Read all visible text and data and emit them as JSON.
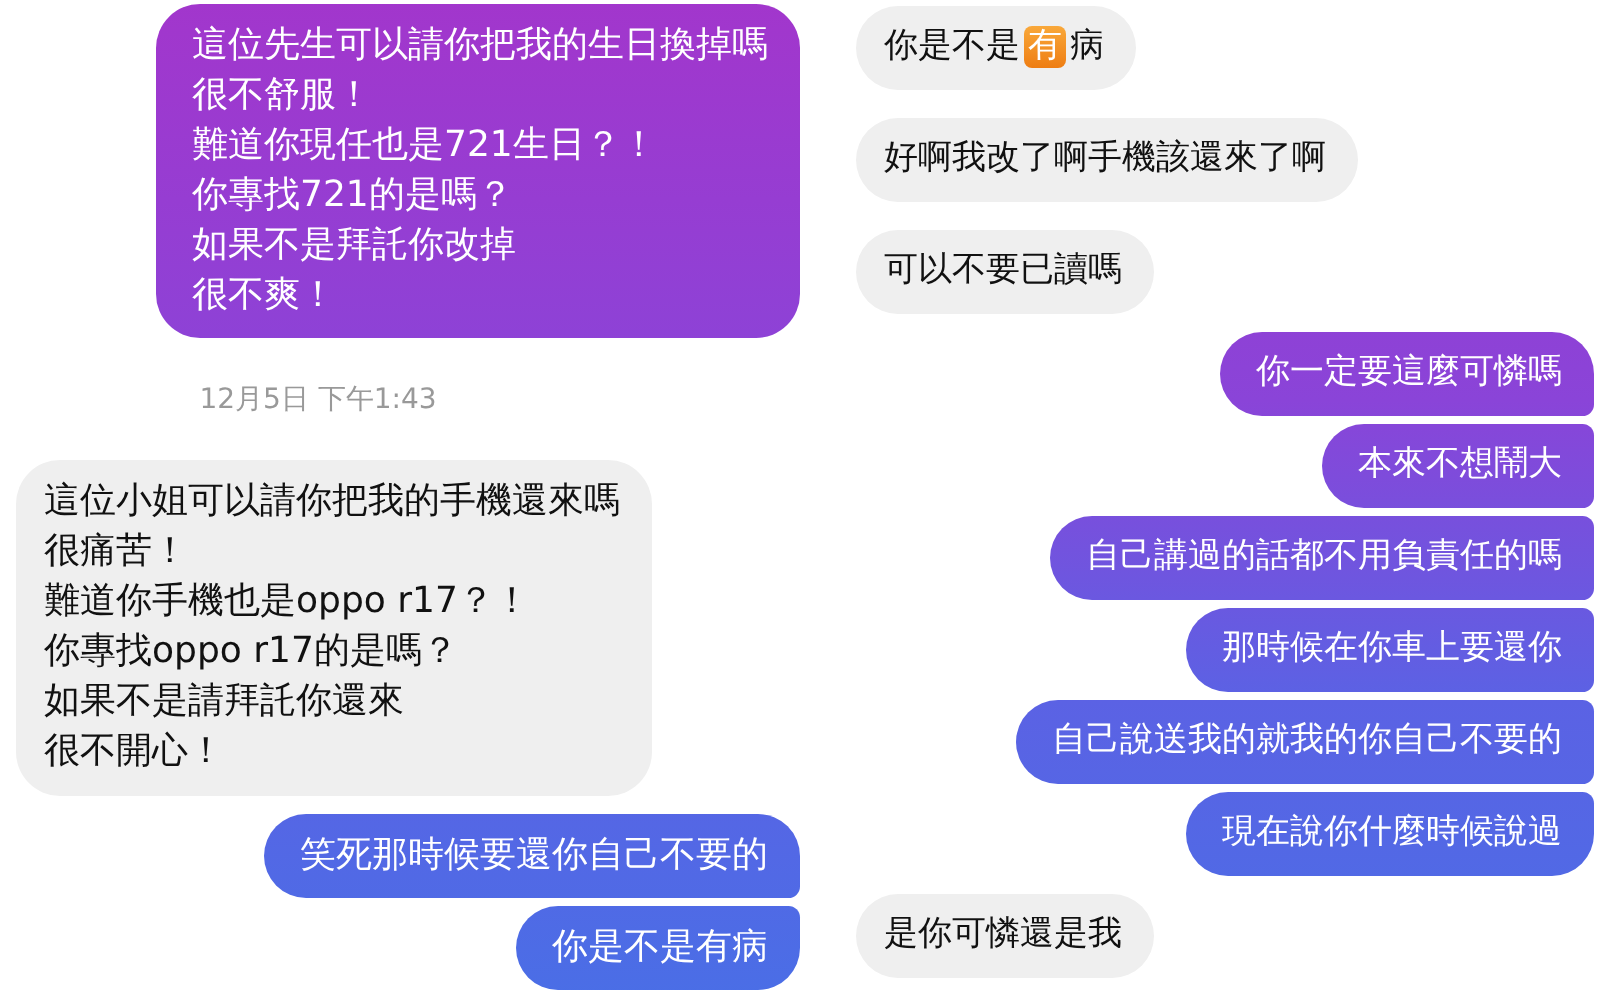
{
  "panels": [
    {
      "messages": [
        {
          "kind": "sent",
          "lines": [
            "這位先生可以請你把我的生日換掉嗎",
            "很不舒服！",
            "難道你現任也是721生日？！",
            "你專找721的是嗎？",
            "如果不是拜託你改掉",
            "很不爽！"
          ]
        },
        {
          "kind": "timestamp",
          "lines": [
            "12月5日 下午1:43"
          ]
        },
        {
          "kind": "received",
          "lines": [
            "這位小姐可以請你把我的手機還來嗎",
            "很痛苦！",
            "難道你手機也是oppo r17？！",
            "你專找oppo r17的是嗎？",
            "如果不是請拜託你還來",
            "很不開心！"
          ]
        },
        {
          "kind": "sent",
          "lines": [
            "笑死那時候要還你自己不要的"
          ]
        },
        {
          "kind": "sent",
          "lines": [
            "你是不是有病"
          ]
        }
      ]
    },
    {
      "messages": [
        {
          "kind": "received",
          "parts": [
            {
              "kind": "text",
              "text": "你是不是"
            },
            {
              "kind": "emoji",
              "text": "有"
            },
            {
              "kind": "text",
              "text": "病"
            }
          ]
        },
        {
          "kind": "received",
          "lines": [
            "好啊我改了啊手機該還來了啊"
          ]
        },
        {
          "kind": "received",
          "lines": [
            "可以不要已讀嗎"
          ]
        },
        {
          "kind": "sent",
          "lines": [
            "你一定要這麼可憐嗎"
          ]
        },
        {
          "kind": "sent",
          "lines": [
            "本來不想鬧大"
          ]
        },
        {
          "kind": "sent",
          "lines": [
            "自己講過的話都不用負責任的嗎"
          ]
        },
        {
          "kind": "sent",
          "lines": [
            "那時候在你車上要還你"
          ]
        },
        {
          "kind": "sent",
          "lines": [
            "自己說送我的就我的你自己不要的"
          ]
        },
        {
          "kind": "sent",
          "lines": [
            "現在說你什麼時候說過"
          ]
        },
        {
          "kind": "received",
          "lines": [
            "是你可憐還是我"
          ]
        }
      ]
    }
  ]
}
